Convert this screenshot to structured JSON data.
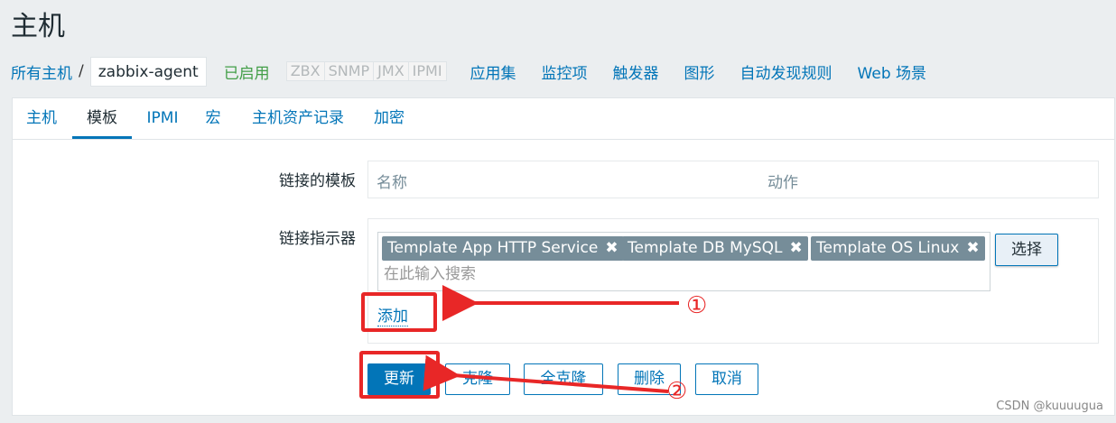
{
  "page": {
    "title": "主机"
  },
  "breadcrumb": {
    "all_hosts": "所有主机",
    "separator": "/",
    "current": "zabbix-agent"
  },
  "host_status": "已启用",
  "availability": [
    "ZBX",
    "SNMP",
    "JMX",
    "IPMI"
  ],
  "host_nav": [
    "应用集",
    "监控项",
    "触发器",
    "图形",
    "自动发现规则",
    "Web 场景"
  ],
  "tabs": [
    {
      "label": "主机",
      "active": false
    },
    {
      "label": "模板",
      "active": true
    },
    {
      "label": "IPMI",
      "active": false
    },
    {
      "label": "宏",
      "active": false
    },
    {
      "label": "主机资产记录",
      "active": false
    },
    {
      "label": "加密",
      "active": false
    }
  ],
  "linked_templates": {
    "label": "链接的模板",
    "columns": [
      "名称",
      "动作"
    ]
  },
  "link_indicator": {
    "label": "链接指示器",
    "chips": [
      "Template App HTTP Service",
      "Template DB MySQL",
      "Template OS Linux"
    ],
    "chip_remove_glyph": "✖",
    "search_placeholder": "在此输入搜索",
    "select_button": "选择",
    "add_link": "添加"
  },
  "actions": {
    "update": "更新",
    "clone": "克隆",
    "full_clone": "全克隆",
    "delete": "删除",
    "cancel": "取消"
  },
  "annotations": {
    "step1": "①",
    "step2": "②",
    "color": "#e82727"
  },
  "watermark": "CSDN @kuuuugua",
  "colors": {
    "link": "#0275b8",
    "enabled": "#429e47",
    "chip": "#768d99",
    "background": "#ebeef0"
  }
}
